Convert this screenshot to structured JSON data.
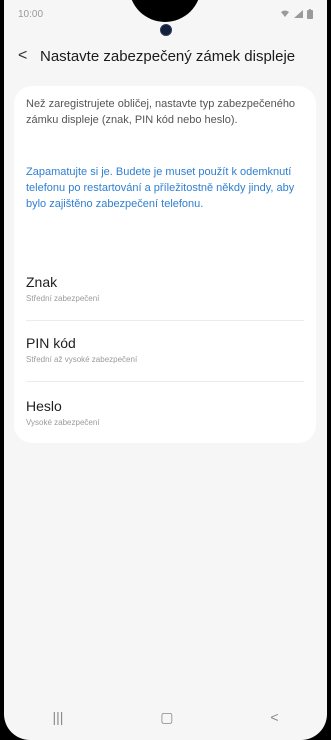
{
  "status_bar": {
    "time": "10:00",
    "wifi_icon": "wifi-icon",
    "signal_icon": "signal-icon",
    "battery_icon": "battery-icon"
  },
  "header": {
    "back_icon": "chevron-left-icon",
    "title": "Nastavte zabezpečený zámek displeje"
  },
  "info": {
    "text": "Než zaregistrujete obličej, nastavte typ zabezpečeného zámku displeje (znak, PIN kód nebo heslo).",
    "note": "Zapamatujte si je. Budete je muset použít k odemknutí telefonu po restartování a příležitostně někdy jindy, aby bylo zajištěno zabezpečení telefonu."
  },
  "options": [
    {
      "title": "Znak",
      "subtitle": "Střední zabezpečení"
    },
    {
      "title": "PIN kód",
      "subtitle": "Střední až vysoké zabezpečení"
    },
    {
      "title": "Heslo",
      "subtitle": "Vysoké zabezpečení"
    }
  ],
  "navbar": {
    "recents": "|||",
    "home": "▢",
    "back": "<"
  },
  "colors": {
    "accent": "#2f7fd1",
    "background": "#f6f6f6",
    "card": "#ffffff"
  }
}
